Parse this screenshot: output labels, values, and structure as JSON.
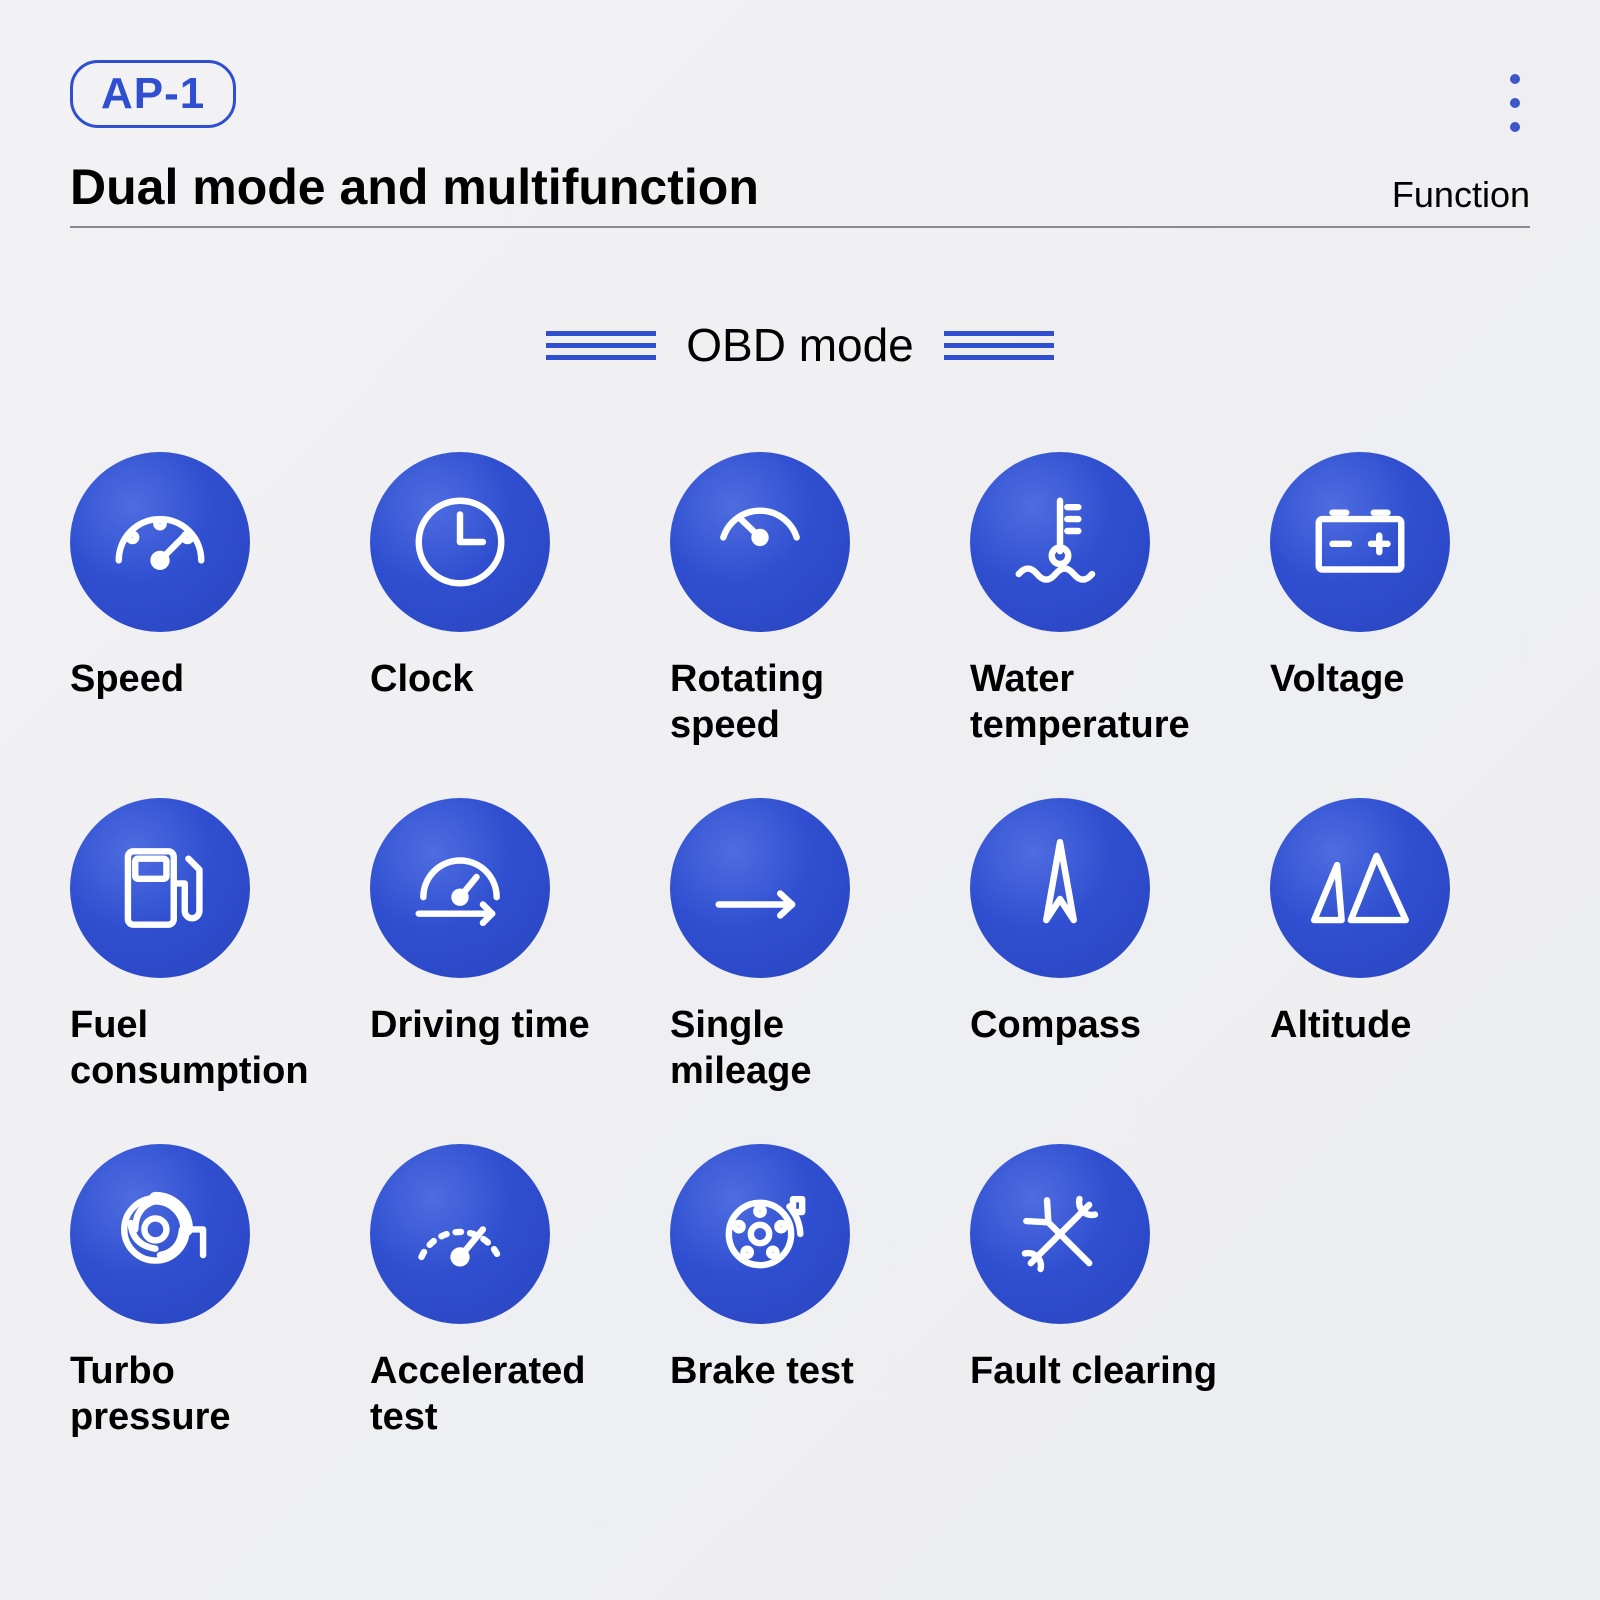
{
  "header": {
    "badge": "AP-1",
    "title": "Dual mode and multifunction",
    "right_label": "Function"
  },
  "section": {
    "title": "OBD mode"
  },
  "items": [
    {
      "label": "Speed",
      "icon": "speed-icon"
    },
    {
      "label": "Clock",
      "icon": "clock-icon"
    },
    {
      "label": "Rotating speed",
      "icon": "rpm-icon"
    },
    {
      "label": "Water temperature",
      "icon": "water-temp-icon"
    },
    {
      "label": "Voltage",
      "icon": "battery-icon"
    },
    {
      "label": "Fuel consumption",
      "icon": "fuel-icon"
    },
    {
      "label": "Driving time",
      "icon": "driving-time-icon"
    },
    {
      "label": "Single mileage",
      "icon": "ab-mileage-icon"
    },
    {
      "label": "Compass",
      "icon": "compass-icon"
    },
    {
      "label": "Altitude",
      "icon": "altitude-icon"
    },
    {
      "label": "Turbo pressure",
      "icon": "turbo-icon"
    },
    {
      "label": "Accelerated test",
      "icon": "accel-icon"
    },
    {
      "label": "Brake test",
      "icon": "brake-icon"
    },
    {
      "label": "Fault clearing",
      "icon": "tools-icon"
    }
  ],
  "colors": {
    "accent": "#2f4fd0"
  }
}
